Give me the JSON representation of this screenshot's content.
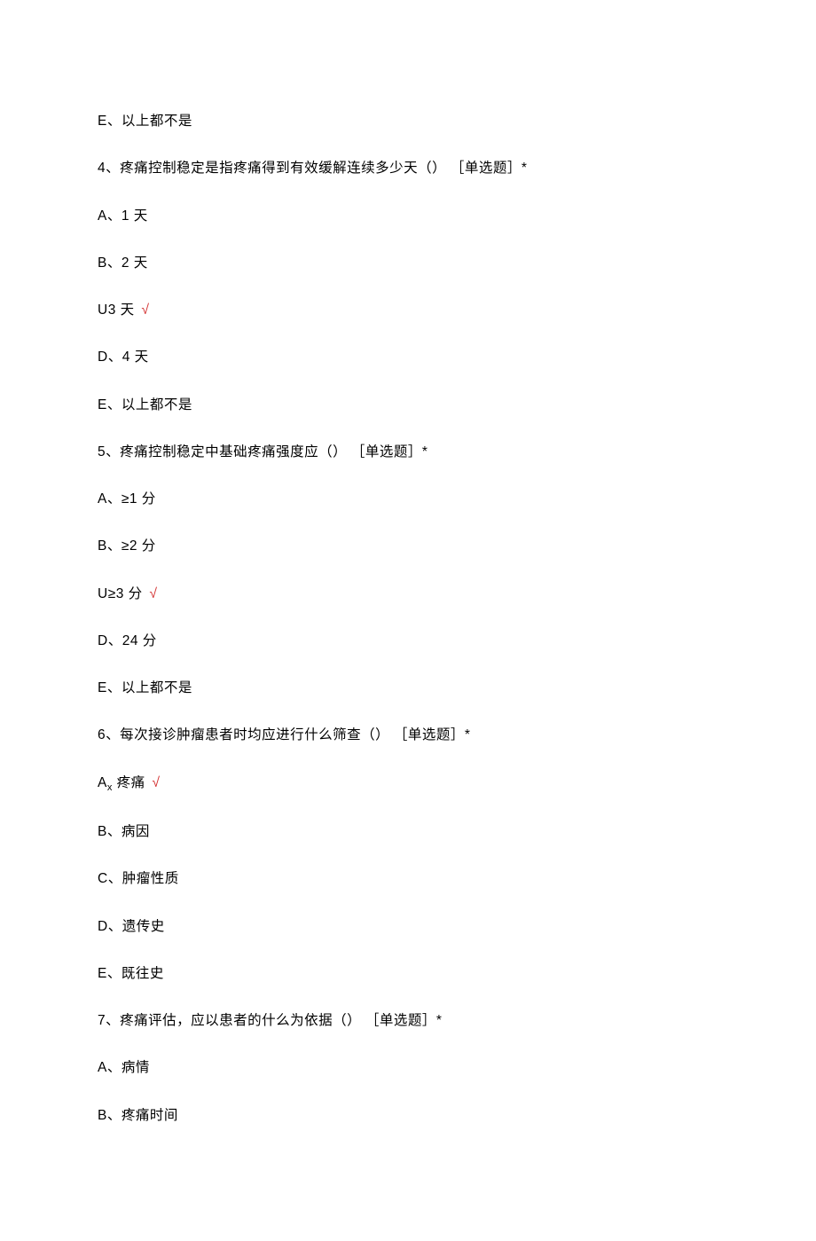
{
  "lines": {
    "l0": "E、以上都不是",
    "q4": "4、疼痛控制稳定是指疼痛得到有效缓解连续多少天（） ［单选题］*",
    "q4a": "A、1 天",
    "q4b": "B、2 天",
    "q4c_prefix": "U3 天",
    "q4d": "D、4 天",
    "q4e": "E、以上都不是",
    "q5": "5、疼痛控制稳定中基础疼痛强度应（） ［单选题］*",
    "q5a": "A、≥1 分",
    "q5b": "B、≥2 分",
    "q5c_prefix": "U≥3 分",
    "q5d": "D、24 分",
    "q5e": "E、以上都不是",
    "q6": "6、每次接诊肿瘤患者时均应进行什么筛查（） ［单选题］*",
    "q6a_before": "A",
    "q6a_sub": "x",
    "q6a_after": " 疼痛",
    "q6b": "B、病因",
    "q6c": "C、肿瘤性质",
    "q6d": "D、遗传史",
    "q6e": "E、既往史",
    "q7": "7、疼痛评估，应以患者的什么为依据（） ［单选题］*",
    "q7a": "A、病情",
    "q7b": "B、疼痛时间",
    "check": "√"
  }
}
